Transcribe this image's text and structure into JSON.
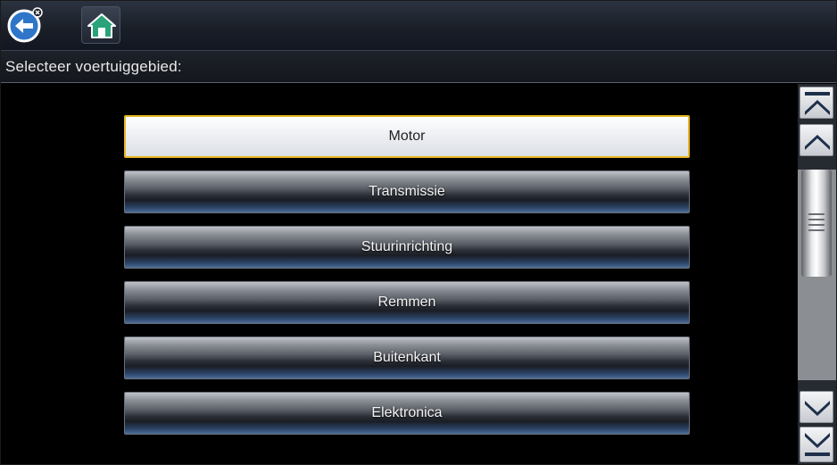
{
  "toolbar": {
    "back_icon": "back-arrow-icon",
    "home_icon": "home-icon"
  },
  "title": "Selecteer voertuiggebied:",
  "menu": {
    "items": [
      {
        "label": "Motor",
        "selected": true
      },
      {
        "label": "Transmissie",
        "selected": false
      },
      {
        "label": "Stuurinrichting",
        "selected": false
      },
      {
        "label": "Remmen",
        "selected": false
      },
      {
        "label": "Buitenkant",
        "selected": false
      },
      {
        "label": "Elektronica",
        "selected": false
      }
    ]
  },
  "scrollbar": {
    "icons": [
      "scroll-top-icon",
      "scroll-up-icon",
      "scroll-down-icon",
      "scroll-bottom-icon"
    ]
  },
  "colors": {
    "selection_border": "#e7b623",
    "back_button": "#2f76c9"
  }
}
